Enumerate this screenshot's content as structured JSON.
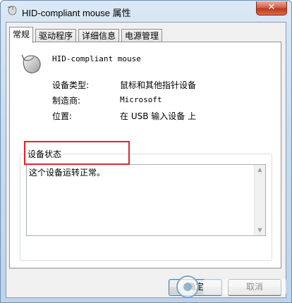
{
  "window": {
    "title": "HID-compliant mouse 属性",
    "close_label": "✕"
  },
  "tabs": [
    {
      "label": "常规",
      "active": true
    },
    {
      "label": "驱动程序",
      "active": false
    },
    {
      "label": "详细信息",
      "active": false
    },
    {
      "label": "电源管理",
      "active": false
    }
  ],
  "general": {
    "device_name": "HID-compliant mouse",
    "properties": [
      {
        "label": "设备类型:",
        "value": "鼠标和其他指针设备"
      },
      {
        "label": "制造商:",
        "value": "Microsoft"
      },
      {
        "label": "位置:",
        "value": "在 USB 输入设备 上"
      }
    ],
    "status_group_label": "设备状态",
    "status_text": "这个设备运转正常。"
  },
  "buttons": {
    "ok": "确定",
    "cancel": "取消"
  },
  "icons": {
    "title": "mouse-icon",
    "device": "mouse-icon",
    "highlight_color": "#e0242a"
  }
}
